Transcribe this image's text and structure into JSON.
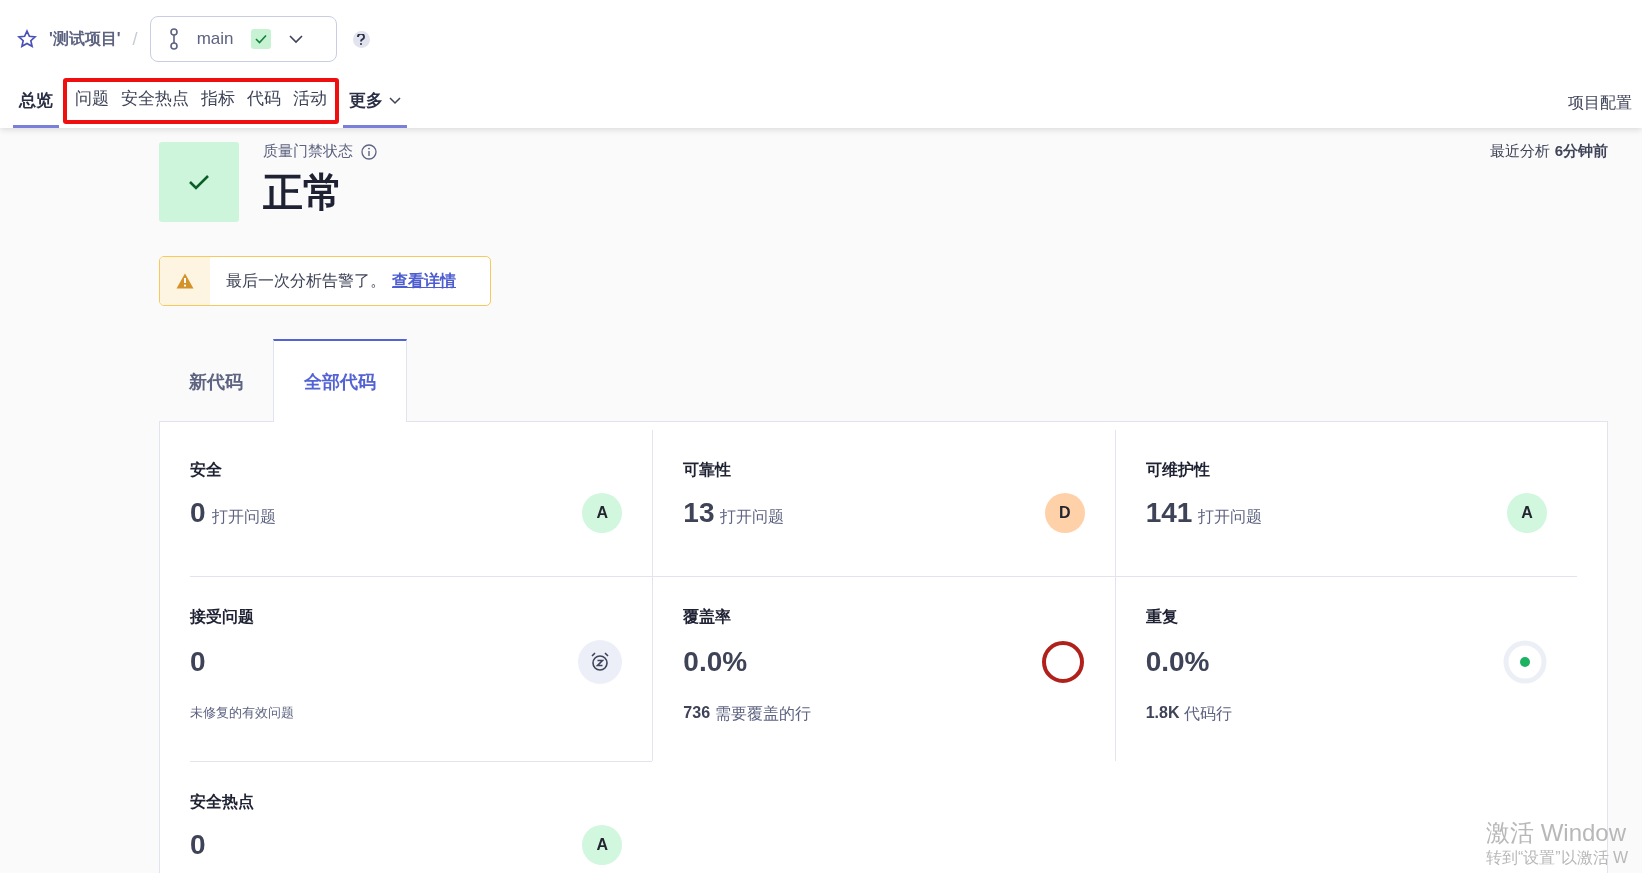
{
  "project": {
    "name": "'测试项目'",
    "separator": "/"
  },
  "branch": {
    "name": "main",
    "status_ok": true
  },
  "nav": {
    "items": [
      {
        "label": "总览",
        "selected": true,
        "highlighted": false
      },
      {
        "label": "问题",
        "selected": false,
        "highlighted": true
      },
      {
        "label": "安全热点",
        "selected": false,
        "highlighted": true
      },
      {
        "label": "指标",
        "selected": false,
        "highlighted": true
      },
      {
        "label": "代码",
        "selected": false,
        "highlighted": true
      },
      {
        "label": "活动",
        "selected": false,
        "highlighted": true
      },
      {
        "label": "更多",
        "selected": true,
        "highlighted": false,
        "kind": "menu"
      }
    ],
    "settings": "项目配置"
  },
  "gate": {
    "label": "质量门禁状态",
    "status": "正常",
    "passed": true
  },
  "last_analysis": {
    "label": "最近分析",
    "time": "6分钟前"
  },
  "warning": {
    "text": "最后一次分析告警了。",
    "link": "查看详情"
  },
  "tabs": [
    {
      "label": "新代码",
      "selected": false
    },
    {
      "label": "全部代码",
      "selected": true
    }
  ],
  "metrics": [
    {
      "kind": "rating",
      "title": "安全",
      "value": "0",
      "unit": "打开问题",
      "rating": "A",
      "color": "#d1f7de"
    },
    {
      "kind": "rating",
      "title": "可靠性",
      "value": "13",
      "unit": "打开问题",
      "rating": "D",
      "color": "#ffd1a8"
    },
    {
      "kind": "rating",
      "title": "可维护性",
      "value": "141",
      "unit": "打开问题",
      "rating": "A",
      "color": "#d1f7de"
    },
    {
      "kind": "accepted",
      "title": "接受问题",
      "value": "0",
      "note": "未修复的有效问题"
    },
    {
      "kind": "coverage",
      "title": "覆盖率",
      "value": "0.0%",
      "note_value": "736",
      "note": "需要覆盖的行"
    },
    {
      "kind": "duplication",
      "title": "重复",
      "value": "0.0%",
      "note_value": "1.8K",
      "note": "代码行"
    },
    {
      "kind": "rating",
      "title": "安全热点",
      "value": "0",
      "rating": "A",
      "color": "#d1f7de"
    }
  ],
  "os_notice": {
    "title": "激活 Window",
    "subtitle": "转到“设置”以激活 W"
  }
}
